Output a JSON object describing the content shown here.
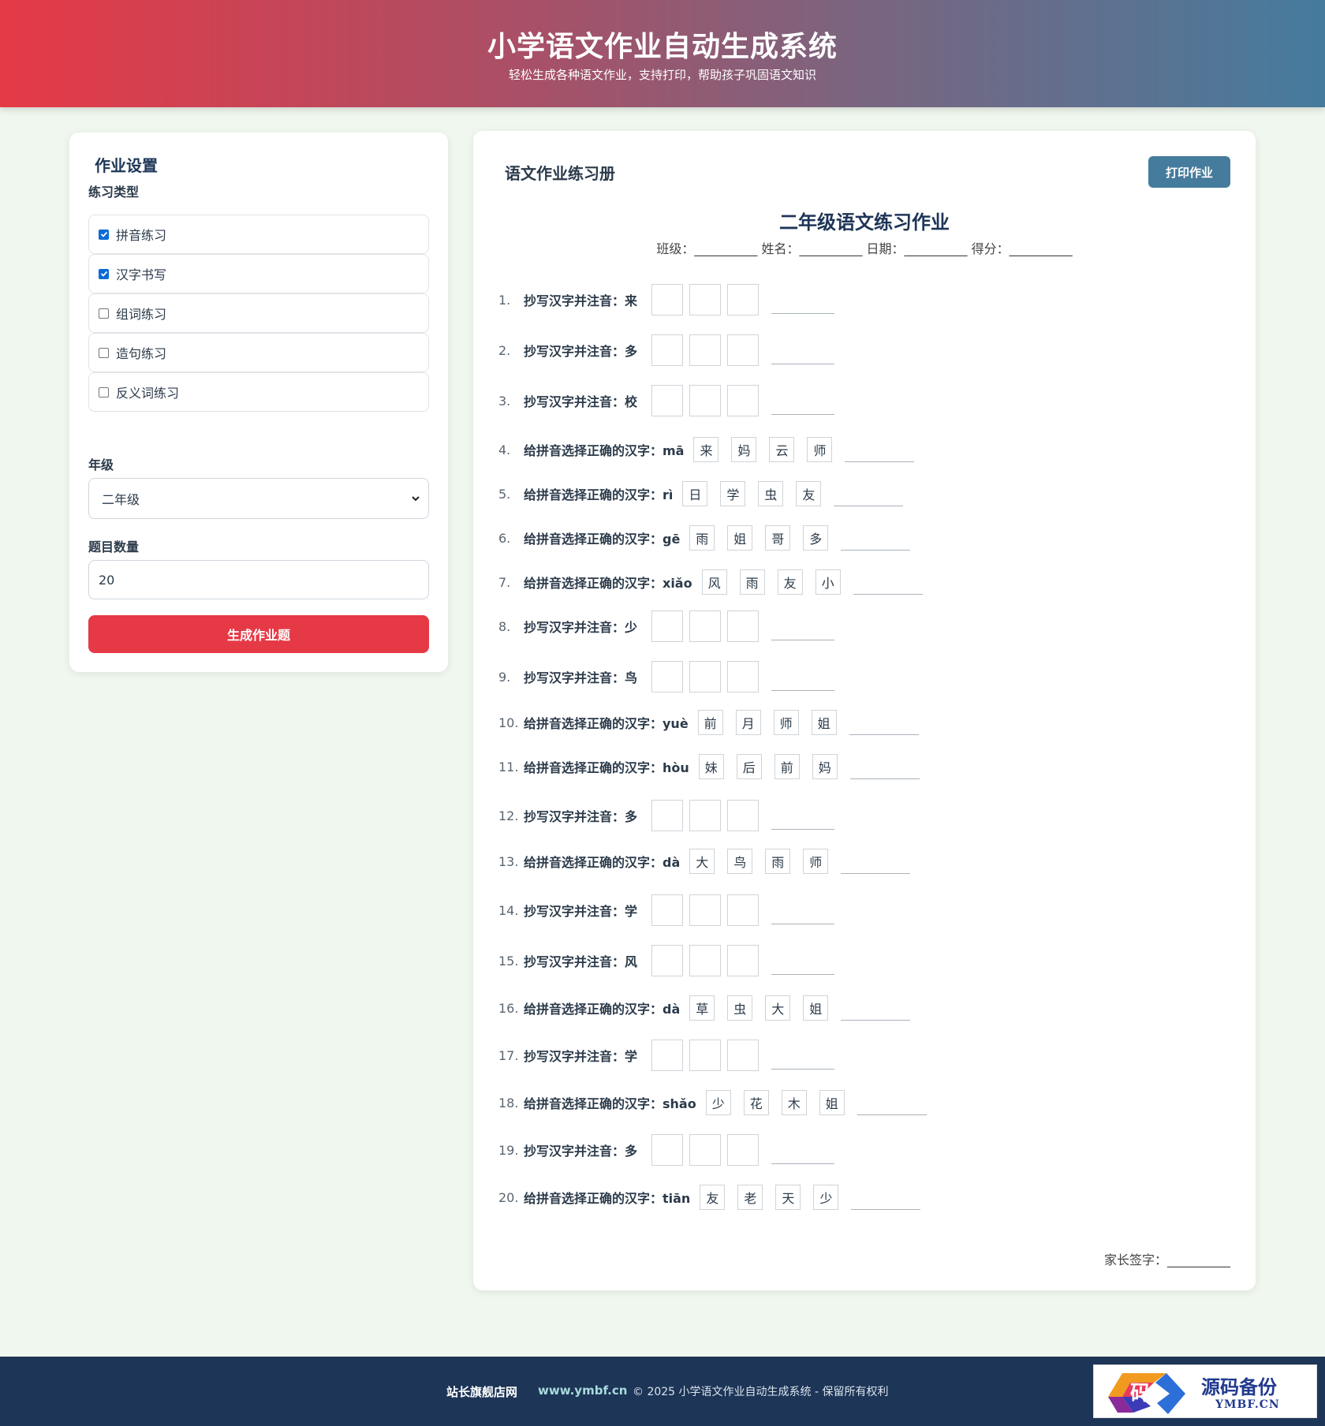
{
  "header": {
    "title": "小学语文作业自动生成系统",
    "subtitle": "轻松生成各种语文作业，支持打印，帮助孩子巩固语文知识"
  },
  "settings": {
    "title": "作业设置",
    "type_label": "练习类型",
    "types": [
      {
        "label": "拼音练习",
        "checked": true
      },
      {
        "label": "汉字书写",
        "checked": true
      },
      {
        "label": "组词练习",
        "checked": false
      },
      {
        "label": "造句练习",
        "checked": false
      },
      {
        "label": "反义词练习",
        "checked": false
      }
    ],
    "grade_label": "年级",
    "grade_value": "二年级",
    "count_label": "题目数量",
    "count_value": "20",
    "generate_label": "生成作业题"
  },
  "sheet": {
    "title": "语文作业练习册",
    "print_label": "打印作业",
    "homework_title": "二年级语文练习作业",
    "info_line": "班级：__________ 姓名：__________ 日期：__________ 得分：__________",
    "sign_line": "家长签字：__________",
    "questions": [
      {
        "num": "1.",
        "text": "抄写汉字并注音：来",
        "kind": "write"
      },
      {
        "num": "2.",
        "text": "抄写汉字并注音：多",
        "kind": "write"
      },
      {
        "num": "3.",
        "text": "抄写汉字并注音：校",
        "kind": "write"
      },
      {
        "num": "4.",
        "text": "给拼音选择正确的汉字：mā",
        "kind": "choice",
        "options": [
          "来",
          "妈",
          "云",
          "师"
        ]
      },
      {
        "num": "5.",
        "text": "给拼音选择正确的汉字：rì",
        "kind": "choice",
        "options": [
          "日",
          "学",
          "虫",
          "友"
        ]
      },
      {
        "num": "6.",
        "text": "给拼音选择正确的汉字：gē",
        "kind": "choice",
        "options": [
          "雨",
          "姐",
          "哥",
          "多"
        ]
      },
      {
        "num": "7.",
        "text": "给拼音选择正确的汉字：xiǎo",
        "kind": "choice",
        "options": [
          "风",
          "雨",
          "友",
          "小"
        ]
      },
      {
        "num": "8.",
        "text": "抄写汉字并注音：少",
        "kind": "write"
      },
      {
        "num": "9.",
        "text": "抄写汉字并注音：鸟",
        "kind": "write"
      },
      {
        "num": "10.",
        "text": "给拼音选择正确的汉字：yuè",
        "kind": "choice",
        "options": [
          "前",
          "月",
          "师",
          "姐"
        ]
      },
      {
        "num": "11.",
        "text": "给拼音选择正确的汉字：hòu",
        "kind": "choice",
        "options": [
          "妹",
          "后",
          "前",
          "妈"
        ]
      },
      {
        "num": "12.",
        "text": "抄写汉字并注音：多",
        "kind": "write"
      },
      {
        "num": "13.",
        "text": "给拼音选择正确的汉字：dà",
        "kind": "choice",
        "options": [
          "大",
          "鸟",
          "雨",
          "师"
        ]
      },
      {
        "num": "14.",
        "text": "抄写汉字并注音：学",
        "kind": "write"
      },
      {
        "num": "15.",
        "text": "抄写汉字并注音：风",
        "kind": "write"
      },
      {
        "num": "16.",
        "text": "给拼音选择正确的汉字：dà",
        "kind": "choice",
        "options": [
          "草",
          "虫",
          "大",
          "姐"
        ]
      },
      {
        "num": "17.",
        "text": "抄写汉字并注音：学",
        "kind": "write"
      },
      {
        "num": "18.",
        "text": "给拼音选择正确的汉字：shǎo",
        "kind": "choice",
        "options": [
          "少",
          "花",
          "木",
          "姐"
        ]
      },
      {
        "num": "19.",
        "text": "抄写汉字并注音：多",
        "kind": "write"
      },
      {
        "num": "20.",
        "text": "给拼音选择正确的汉字：tiān",
        "kind": "choice",
        "options": [
          "友",
          "老",
          "天",
          "少"
        ]
      }
    ]
  },
  "footer": {
    "store": "站长旗舰店网",
    "url": "www.ymbf.cn",
    "copyright": "© 2025 小学语文作业自动生成系统 - 保留所有权利"
  },
  "logo": {
    "glyph": "码",
    "name": "源码备份",
    "domain": "YMBF.CN"
  },
  "colors": {
    "accent_red": "#e63946",
    "accent_blue": "#457b9d",
    "navy": "#1d3557"
  }
}
